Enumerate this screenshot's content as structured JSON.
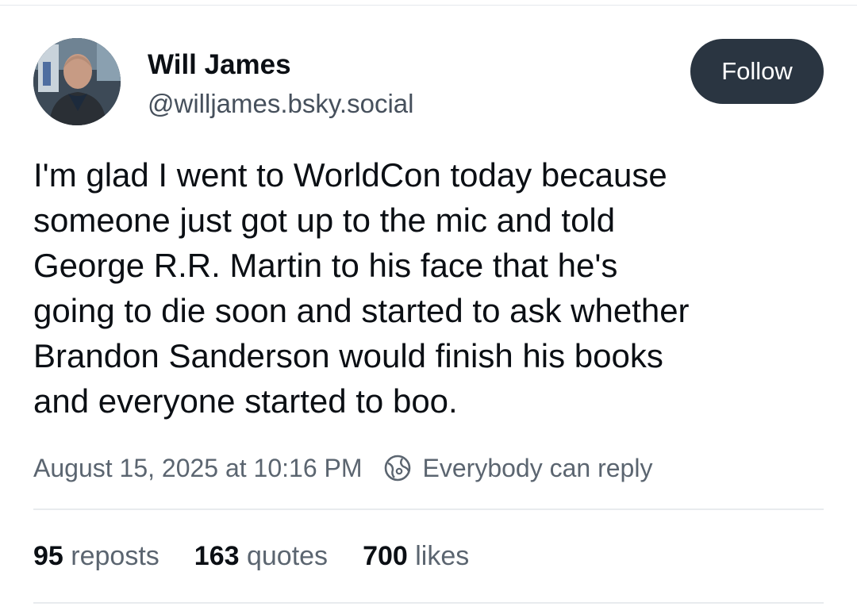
{
  "post": {
    "author": {
      "display_name": "Will James",
      "handle": "@willjames.bsky.social"
    },
    "follow_label": "Follow",
    "text_lines": [
      "I'm glad I went to WorldCon today because",
      "someone just got up to the mic and told",
      "George R.R. Martin to his face that he's",
      "going to die soon and started to ask whether",
      "Brandon Sanderson would finish his books",
      "and everyone started to boo."
    ],
    "timestamp": "August 15, 2025 at 10:16 PM",
    "reply_setting": "Everybody can reply",
    "reply_setting_icon": "globe-icon",
    "stats": {
      "reposts": {
        "count": "95",
        "label": "reposts"
      },
      "quotes": {
        "count": "163",
        "label": "quotes"
      },
      "likes": {
        "count": "700",
        "label": "likes"
      }
    }
  },
  "colors": {
    "follow_button_bg": "#2a3541",
    "text_primary": "#0b0f14",
    "text_secondary": "#5b6570",
    "divider": "#e8ebee"
  }
}
